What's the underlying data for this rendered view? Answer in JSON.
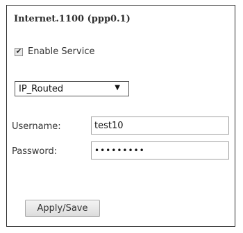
{
  "panel": {
    "title": "Internet.1100 (ppp0.1)"
  },
  "enable_service": {
    "label": "Enable Service",
    "checked": true,
    "check_glyph": "✔"
  },
  "mode_select": {
    "selected": "IP_Routed",
    "arrow_glyph": "▼"
  },
  "credentials": {
    "username_label": "Username:",
    "username_value": "test10",
    "password_label": "Password:",
    "password_value": "•••••••••"
  },
  "actions": {
    "apply_label": "Apply/Save"
  }
}
